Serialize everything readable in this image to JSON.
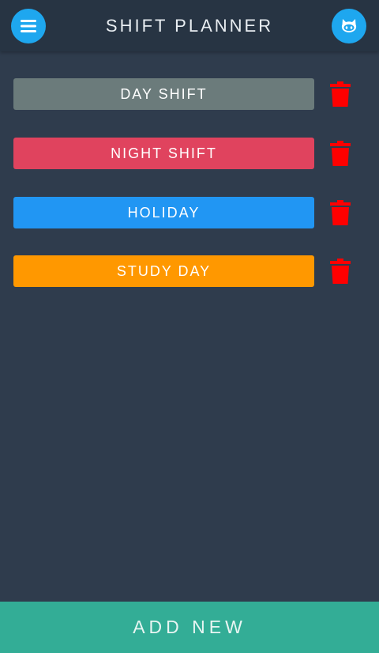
{
  "header": {
    "title": "SHIFT PLANNER",
    "menu_icon": "hamburger-menu-icon",
    "avatar_icon": "octocat-icon",
    "accent_color": "#1ea7ef"
  },
  "shifts": [
    {
      "label": "DAY SHIFT",
      "color": "#6b7b7b"
    },
    {
      "label": "NIGHT SHIFT",
      "color": "#e0435e"
    },
    {
      "label": "HOLIDAY",
      "color": "#2196f3"
    },
    {
      "label": "STUDY DAY",
      "color": "#ff9800"
    }
  ],
  "delete_icon": "trash-icon",
  "delete_color": "#ff0000",
  "footer": {
    "add_label": "ADD NEW",
    "color": "#33ad96"
  }
}
